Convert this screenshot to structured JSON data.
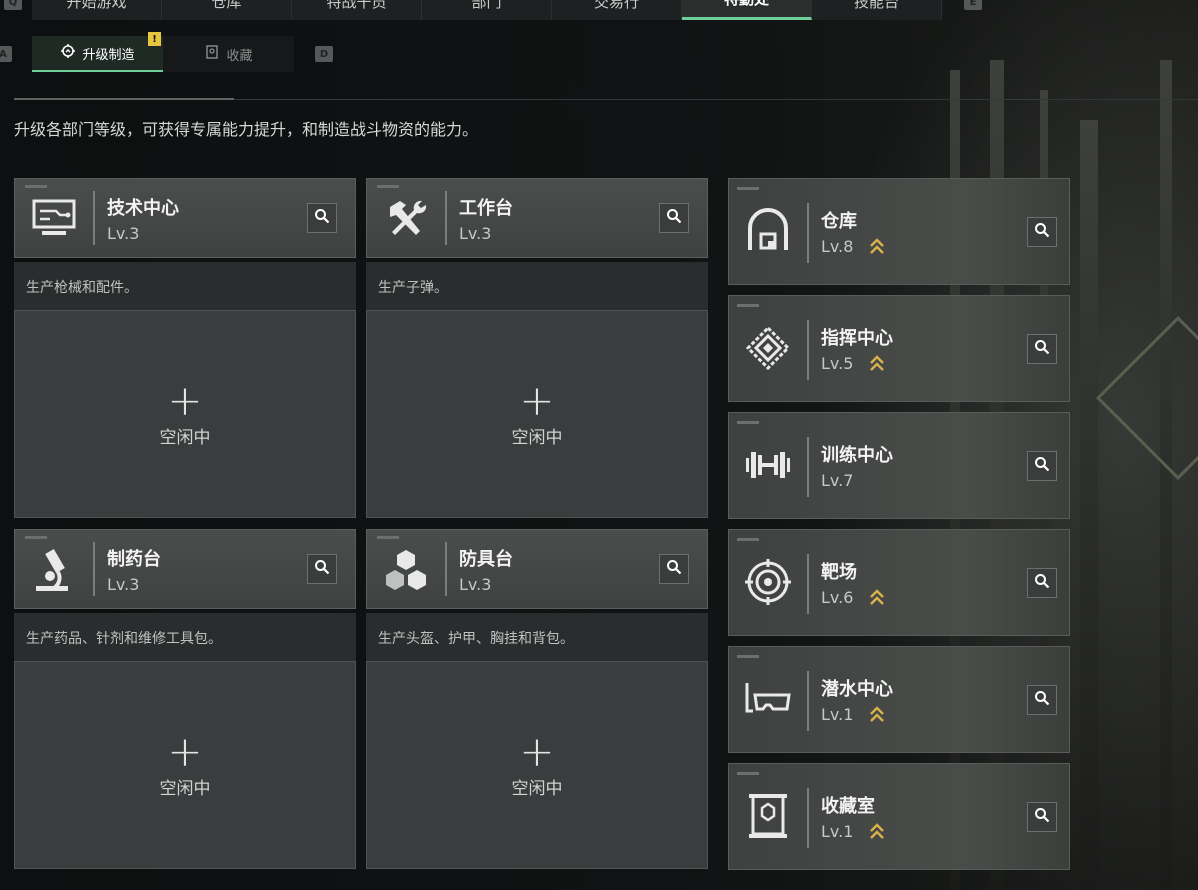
{
  "top_nav": {
    "left_key": "Q",
    "right_key": "E",
    "tabs": [
      "开始游戏",
      "仓库",
      "特战干员",
      "部门",
      "交易行",
      "特勤处",
      "技能台"
    ],
    "active_index": 5
  },
  "sub_tabs": {
    "left_key": "A",
    "right_key": "D",
    "items": [
      {
        "label": "升级制造",
        "icon": "upgrade-gear-icon",
        "active": true,
        "badge": "!"
      },
      {
        "label": "收藏",
        "icon": "collection-icon",
        "active": false
      }
    ]
  },
  "description": "升级各部门等级，可获得专属能力提升，和制造战斗物资的能力。",
  "workbenches": [
    {
      "name": "技术中心",
      "level": "Lv.3",
      "icon": "tech-center-icon",
      "desc": "生产枪械和配件。",
      "slot_plus": "+",
      "slot_status": "空闲中"
    },
    {
      "name": "工作台",
      "level": "Lv.3",
      "icon": "hammer-wrench-icon",
      "desc": "生产子弹。",
      "slot_plus": "+",
      "slot_status": "空闲中"
    },
    {
      "name": "制药台",
      "level": "Lv.3",
      "icon": "microscope-icon",
      "desc": "生产药品、针剂和维修工具包。",
      "slot_plus": "+",
      "slot_status": "空闲中"
    },
    {
      "name": "防具台",
      "level": "Lv.3",
      "icon": "armor-cubes-icon",
      "desc": "生产头盔、护甲、胸挂和背包。",
      "slot_plus": "+",
      "slot_status": "空闲中"
    }
  ],
  "facilities": [
    {
      "name": "仓库",
      "level": "Lv.8",
      "icon": "warehouse-icon",
      "upgradable": true
    },
    {
      "name": "指挥中心",
      "level": "Lv.5",
      "icon": "command-center-icon",
      "upgradable": true
    },
    {
      "name": "训练中心",
      "level": "Lv.7",
      "icon": "dumbbell-icon",
      "upgradable": false
    },
    {
      "name": "靶场",
      "level": "Lv.6",
      "icon": "target-icon",
      "upgradable": true
    },
    {
      "name": "潜水中心",
      "level": "Lv.1",
      "icon": "diving-mask-icon",
      "upgradable": true
    },
    {
      "name": "收藏室",
      "level": "Lv.1",
      "icon": "collection-room-icon",
      "upgradable": true
    }
  ],
  "colors": {
    "accent_green": "#6fcf9a",
    "badge_yellow": "#e8c541",
    "upgrade_gold": "#d9b24a"
  }
}
